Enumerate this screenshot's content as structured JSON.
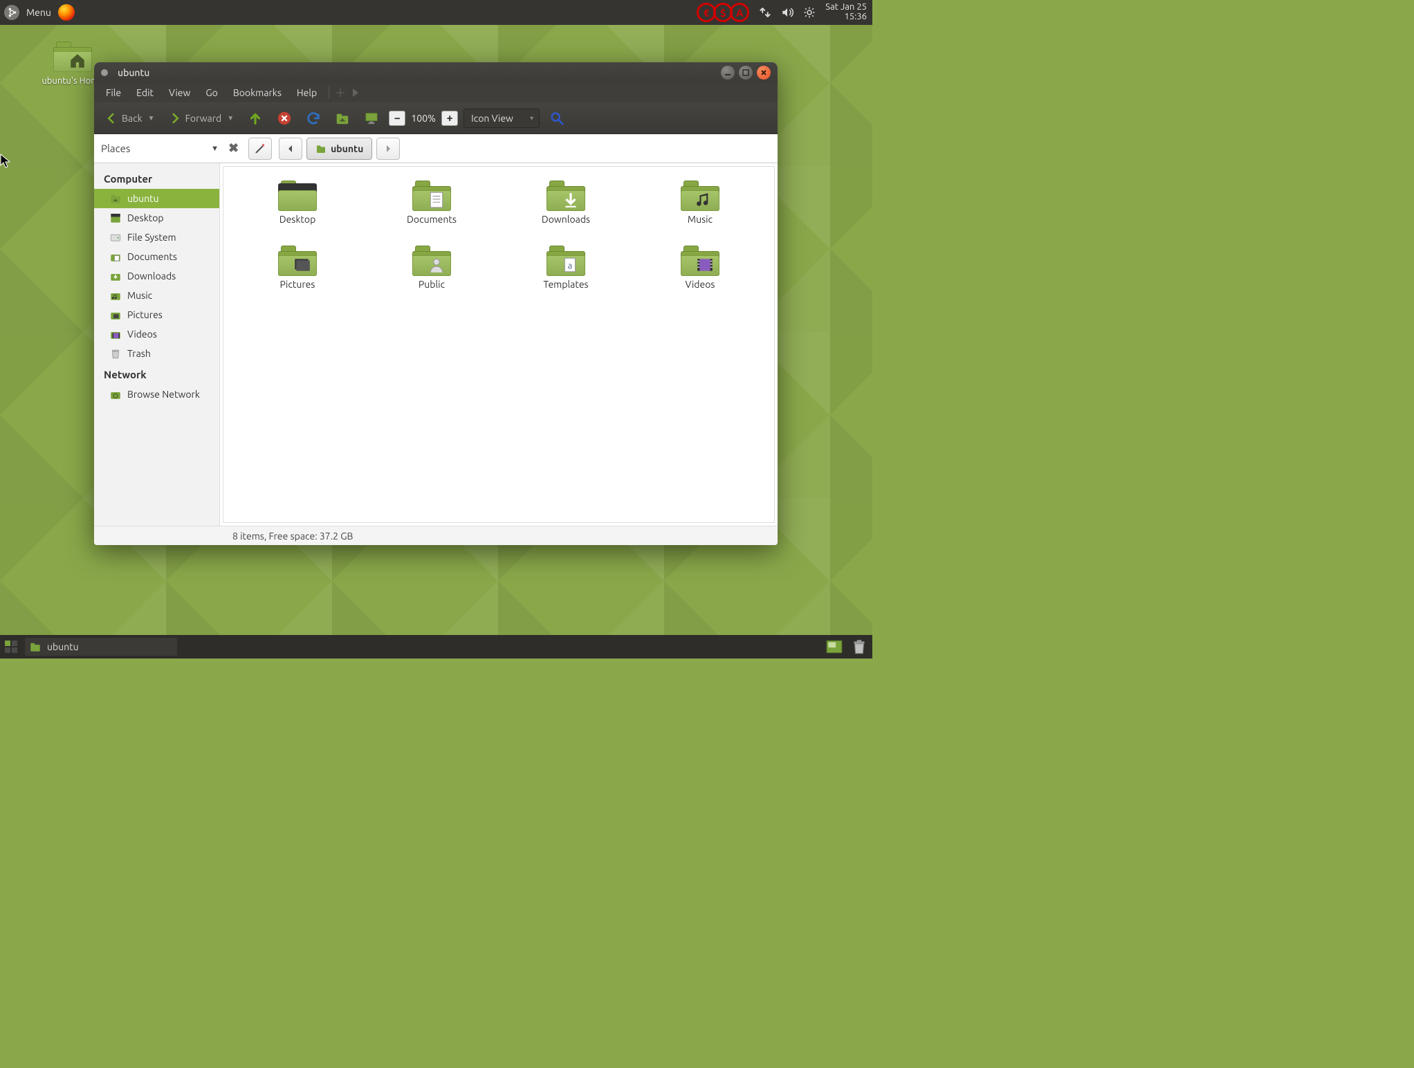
{
  "top_panel": {
    "menu_label": "Menu",
    "indicators": [
      "€",
      "$",
      "A"
    ],
    "date": "Sat Jan 25",
    "time": "15:36"
  },
  "desktop": {
    "home_label": "ubuntu's Home"
  },
  "window": {
    "title": "ubuntu",
    "menus": [
      "File",
      "Edit",
      "View",
      "Go",
      "Bookmarks",
      "Help"
    ],
    "toolbar": {
      "back": "Back",
      "forward": "Forward",
      "zoom": "100%",
      "view_mode": "Icon View"
    },
    "places_label": "Places",
    "breadcrumb": "ubuntu",
    "sidebar": {
      "section_computer": "Computer",
      "section_network": "Network",
      "items_computer": [
        {
          "label": "ubuntu",
          "icon": "home",
          "selected": true
        },
        {
          "label": "Desktop",
          "icon": "desktop"
        },
        {
          "label": "File System",
          "icon": "drive"
        },
        {
          "label": "Documents",
          "icon": "documents"
        },
        {
          "label": "Downloads",
          "icon": "downloads"
        },
        {
          "label": "Music",
          "icon": "music"
        },
        {
          "label": "Pictures",
          "icon": "pictures"
        },
        {
          "label": "Videos",
          "icon": "videos"
        },
        {
          "label": "Trash",
          "icon": "trash"
        }
      ],
      "items_network": [
        {
          "label": "Browse Network",
          "icon": "network"
        }
      ]
    },
    "folders": [
      {
        "label": "Desktop",
        "type": "desktop"
      },
      {
        "label": "Documents",
        "type": "documents"
      },
      {
        "label": "Downloads",
        "type": "downloads"
      },
      {
        "label": "Music",
        "type": "music"
      },
      {
        "label": "Pictures",
        "type": "pictures"
      },
      {
        "label": "Public",
        "type": "public"
      },
      {
        "label": "Templates",
        "type": "templates"
      },
      {
        "label": "Videos",
        "type": "videos"
      }
    ],
    "status": "8 items, Free space: 37.2 GB"
  },
  "bottom_panel": {
    "task_label": "ubuntu"
  }
}
